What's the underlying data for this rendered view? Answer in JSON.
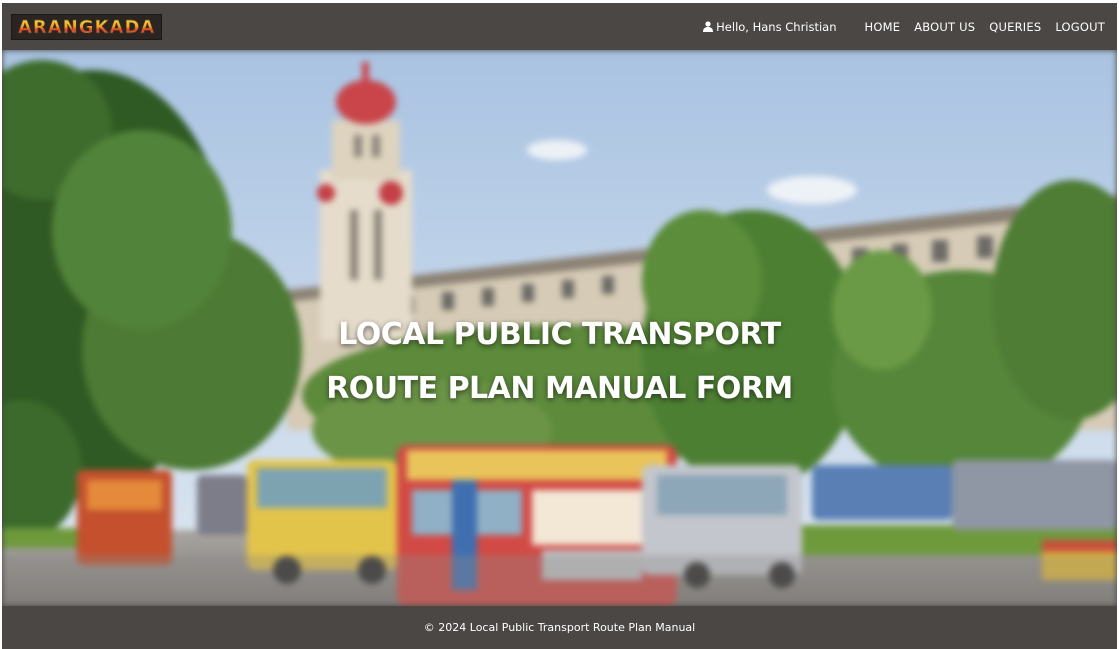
{
  "navbar": {
    "logo_text": "ARANGKADA",
    "greeting_icon": "user-icon",
    "greeting": "Hello, Hans Christian",
    "links": [
      "HOME",
      "ABOUT US",
      "QUERIES",
      "LOGOUT"
    ]
  },
  "hero": {
    "title_line1": "LOCAL PUBLIC TRANSPORT",
    "title_line2": "ROUTE PLAN MANUAL FORM"
  },
  "footer": {
    "text": "© 2024 Local Public Transport Route Plan Manual"
  },
  "colors": {
    "navbar_bg": "#4b4745",
    "footer_bg": "#4b4745",
    "text": "#ffffff"
  }
}
